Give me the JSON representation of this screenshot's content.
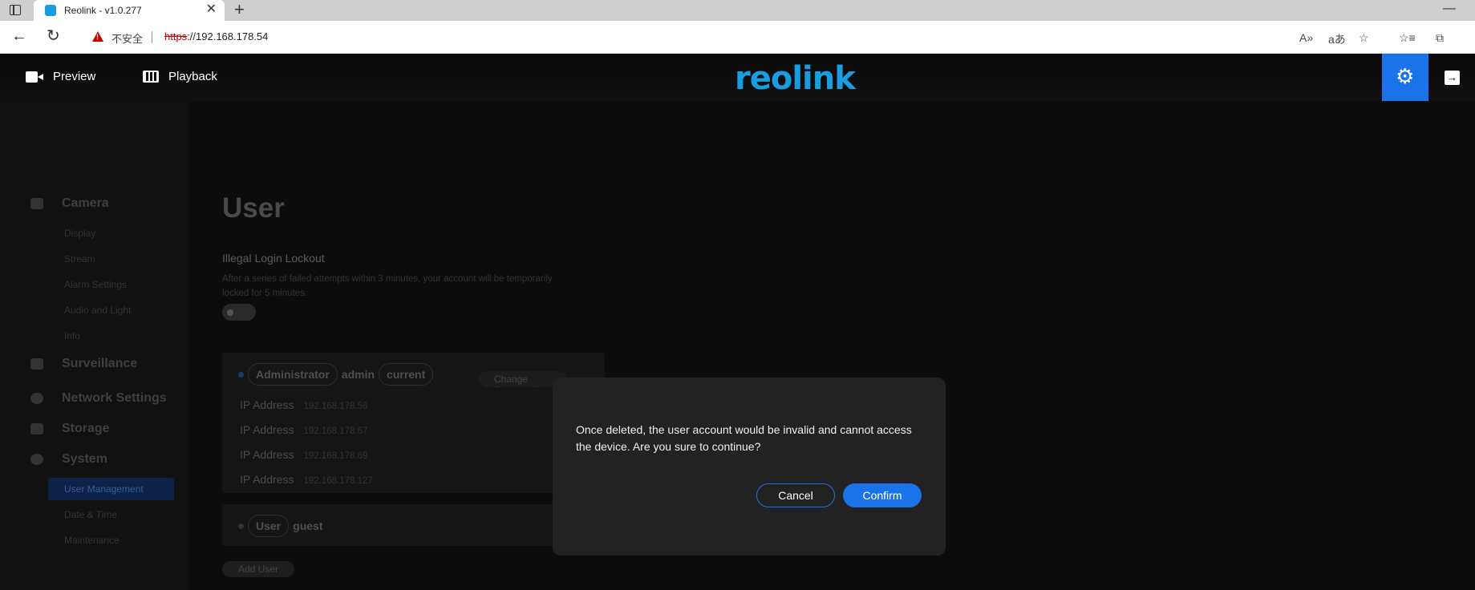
{
  "browser": {
    "tab_title": "Reolink - v1.0.277",
    "close_glyph": "✕",
    "newtab_glyph": "+",
    "minimize_glyph": "—",
    "back_glyph": "←",
    "reload_glyph": "↻",
    "insecure_label": "不安全",
    "url_scheme": "https",
    "url_rest": "://192.168.178.54",
    "read_aloud_glyph": "A»",
    "translate_glyph": "aあ",
    "favorite_add_glyph": "☆",
    "favorites_glyph": "☆≡",
    "collections_glyph": "⧉"
  },
  "header": {
    "preview_label": "Preview",
    "playback_label": "Playback",
    "logo_text": "reolink",
    "settings_glyph": "⚙",
    "logout_glyph": "→"
  },
  "sidebar": {
    "camera": "Camera",
    "camera_items": [
      "Display",
      "Stream",
      "Alarm Settings",
      "Audio and Light",
      "Info"
    ],
    "surveillance": "Surveillance",
    "network": "Network Settings",
    "storage": "Storage",
    "system": "System",
    "system_items": [
      "User Management",
      "Date & Time",
      "Maintenance"
    ]
  },
  "main": {
    "title": "User",
    "lockout_label": "Illegal Login Lockout",
    "lockout_desc": "After a series of failed attempts within 3 minutes, your account will be temporarily locked for 5 minutes.",
    "admin_card": {
      "role": "Administrator",
      "name": "admin",
      "tag": "current",
      "ip_label": "IP Address",
      "ips": [
        "192.168.178.56",
        "192.168.178.67",
        "192.168.178.69",
        "192.168.178.127"
      ],
      "change_password": "Change Password"
    },
    "guest_card": {
      "role": "User",
      "name": "guest"
    },
    "add_user": "Add User"
  },
  "modal": {
    "message": "Once deleted, the user account would be invalid and cannot access the device. Are you sure to continue?",
    "cancel": "Cancel",
    "confirm": "Confirm"
  },
  "colors": {
    "accent": "#1a73e8",
    "logo": "#1a9de0",
    "modal_bg": "#222223"
  }
}
